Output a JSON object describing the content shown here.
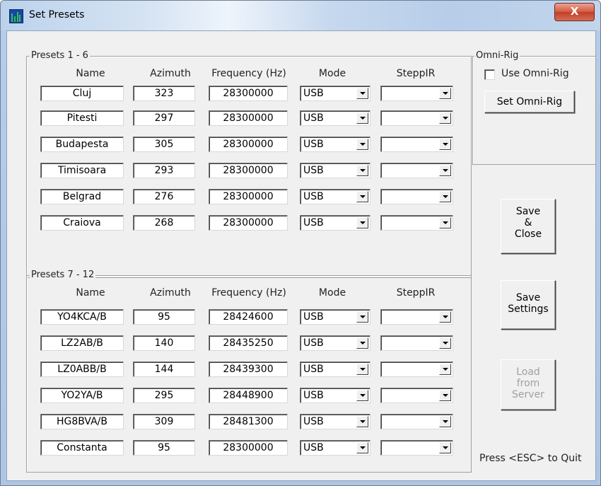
{
  "window": {
    "title": "Set Presets",
    "close_symbol": "X"
  },
  "columns": {
    "name": "Name",
    "azimuth": "Azimuth",
    "frequency": "Frequency (Hz)",
    "mode": "Mode",
    "steppir": "SteppIR"
  },
  "group1": {
    "title": "Presets 1 - 6",
    "rows": [
      {
        "name": "Cluj",
        "azimuth": "323",
        "frequency": "28300000",
        "mode": "USB",
        "steppir": ""
      },
      {
        "name": "Pitesti",
        "azimuth": "297",
        "frequency": "28300000",
        "mode": "USB",
        "steppir": ""
      },
      {
        "name": "Budapesta",
        "azimuth": "305",
        "frequency": "28300000",
        "mode": "USB",
        "steppir": ""
      },
      {
        "name": "Timisoara",
        "azimuth": "293",
        "frequency": "28300000",
        "mode": "USB",
        "steppir": ""
      },
      {
        "name": "Belgrad",
        "azimuth": "276",
        "frequency": "28300000",
        "mode": "USB",
        "steppir": ""
      },
      {
        "name": "Craiova",
        "azimuth": "268",
        "frequency": "28300000",
        "mode": "USB",
        "steppir": ""
      }
    ]
  },
  "group2": {
    "title": "Presets 7 - 12",
    "rows": [
      {
        "name": "YO4KCA/B",
        "azimuth": "95",
        "frequency": "28424600",
        "mode": "USB",
        "steppir": ""
      },
      {
        "name": "LZ2AB/B",
        "azimuth": "140",
        "frequency": "28435250",
        "mode": "USB",
        "steppir": ""
      },
      {
        "name": "LZ0ABB/B",
        "azimuth": "144",
        "frequency": "28439300",
        "mode": "USB",
        "steppir": ""
      },
      {
        "name": "YO2YA/B",
        "azimuth": "295",
        "frequency": "28448900",
        "mode": "USB",
        "steppir": ""
      },
      {
        "name": "HG8BVA/B",
        "azimuth": "309",
        "frequency": "28481300",
        "mode": "USB",
        "steppir": ""
      },
      {
        "name": "Constanta",
        "azimuth": "95",
        "frequency": "28300000",
        "mode": "USB",
        "steppir": ""
      }
    ]
  },
  "omnirig": {
    "title": "Omni-Rig",
    "use_label": "Use Omni-Rig",
    "use_checked": false,
    "set_button": "Set Omni-Rig"
  },
  "buttons": {
    "save_close": [
      "Save",
      "&",
      "Close"
    ],
    "save_settings": [
      "Save",
      "Settings"
    ],
    "load_server": [
      "Load",
      "from",
      "Server"
    ],
    "load_server_enabled": false
  },
  "hint": "Press <ESC> to Quit"
}
